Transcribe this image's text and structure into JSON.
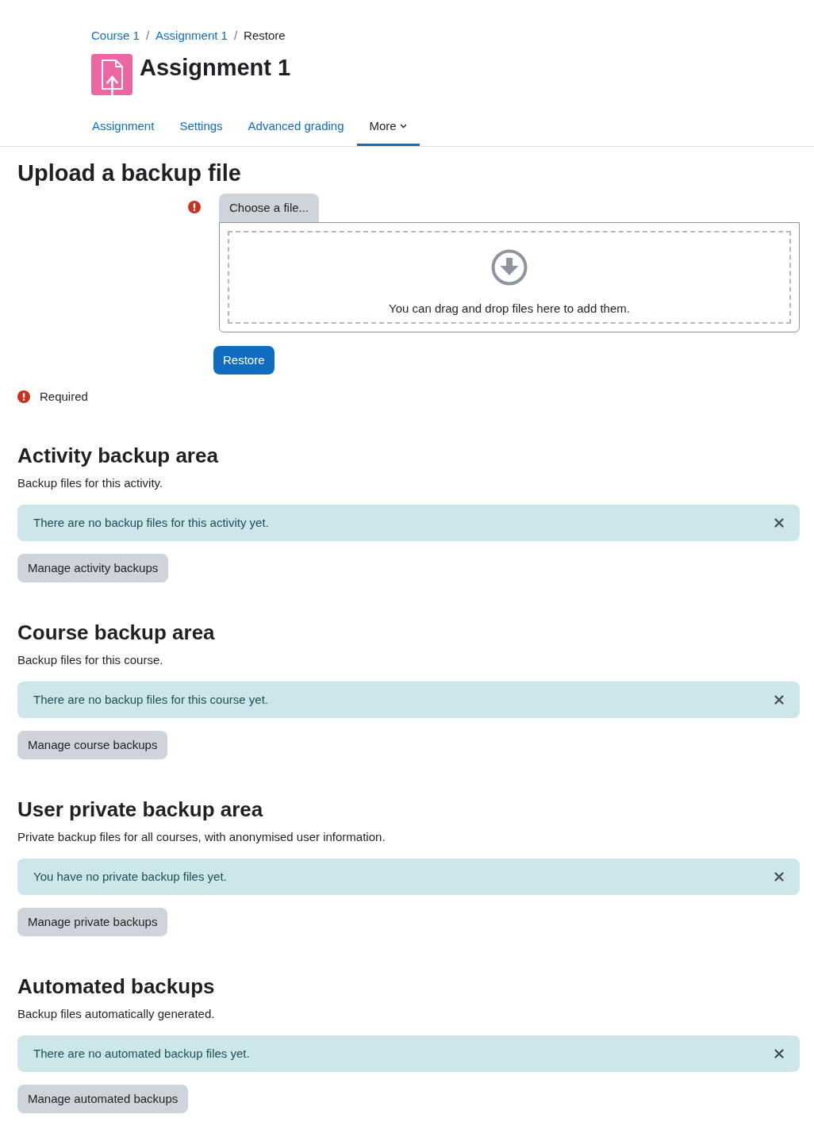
{
  "breadcrumb": [
    {
      "kind": "link",
      "label": "Course 1"
    },
    {
      "kind": "separator",
      "label": "/"
    },
    {
      "kind": "link",
      "label": "Assignment 1"
    },
    {
      "kind": "separator",
      "label": "/"
    },
    {
      "kind": "current",
      "label": "Restore"
    }
  ],
  "page_title": "Assignment 1",
  "tabs": [
    {
      "label": "Assignment",
      "selected": false,
      "kind": "link"
    },
    {
      "label": "Settings",
      "selected": false,
      "kind": "link"
    },
    {
      "label": "Advanced grading",
      "selected": false,
      "kind": "link"
    },
    {
      "label": "More",
      "selected": true,
      "kind": "menu"
    }
  ],
  "upload": {
    "heading": "Upload a backup file",
    "required": true,
    "choose_button": "Choose a file...",
    "dropzone_text": "You can drag and drop files here to add them.",
    "submit_button": "Restore"
  },
  "required_note": "Required",
  "sections": [
    {
      "heading": "Activity backup area",
      "description": "Backup files for this activity.",
      "alert": "There are no backup files for this activity yet.",
      "button": "Manage activity backups"
    },
    {
      "heading": "Course backup area",
      "description": "Backup files for this course.",
      "alert": "There are no backup files for this course yet.",
      "button": "Manage course backups"
    },
    {
      "heading": "User private backup area",
      "description": "Private backup files for all courses, with anonymised user information.",
      "alert": "You have no private backup files yet.",
      "button": "Manage private backups"
    },
    {
      "heading": "Automated backups",
      "description": "Backup files automatically generated.",
      "alert": "There are no automated backup files yet.",
      "button": "Manage automated backups"
    }
  ]
}
